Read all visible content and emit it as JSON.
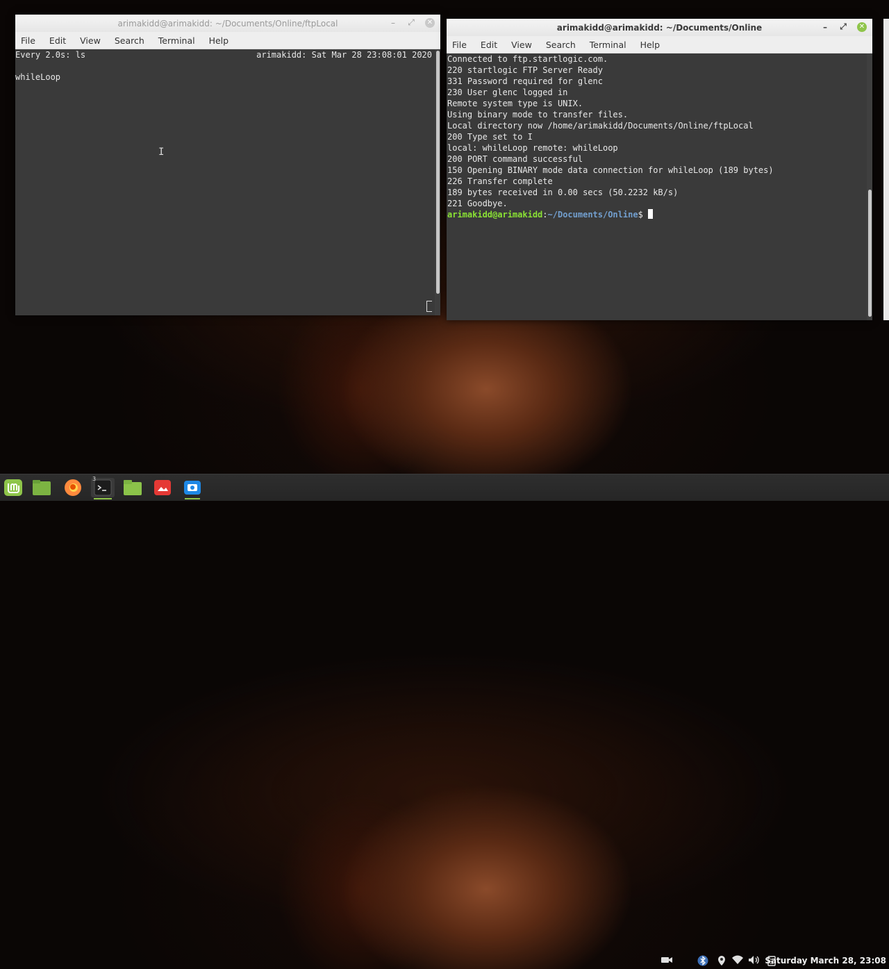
{
  "left_window": {
    "title": "arimakidd@arimakidd: ~/Documents/Online/ftpLocal",
    "menu": [
      "File",
      "Edit",
      "View",
      "Search",
      "Terminal",
      "Help"
    ],
    "header_left": "Every 2.0s: ls",
    "header_right": "arimakidd: Sat Mar 28 23:08:01 2020",
    "listing": [
      "whileLoop"
    ]
  },
  "right_window": {
    "title": "arimakidd@arimakidd: ~/Documents/Online",
    "menu": [
      "File",
      "Edit",
      "View",
      "Search",
      "Terminal",
      "Help"
    ],
    "lines": [
      "Connected to ftp.startlogic.com.",
      "220 startlogic FTP Server Ready",
      "331 Password required for glenc",
      "230 User glenc logged in",
      "Remote system type is UNIX.",
      "Using binary mode to transfer files.",
      "Local directory now /home/arimakidd/Documents/Online/ftpLocal",
      "200 Type set to I",
      "local: whileLoop remote: whileLoop",
      "200 PORT command successful",
      "150 Opening BINARY mode data connection for whileLoop (189 bytes)",
      "226 Transfer complete",
      "189 bytes received in 0.00 secs (50.2232 kB/s)",
      "221 Goodbye."
    ],
    "prompt_user": "arimakidd@arimakidd",
    "prompt_sep": ":",
    "prompt_path": "~/Documents/Online",
    "prompt_symbol": "$ "
  },
  "taskbar": {
    "apps": [
      {
        "icon": "mint-menu-icon",
        "color": "#8fc54a"
      },
      {
        "icon": "files-icon",
        "color": "#7cb342"
      },
      {
        "icon": "firefox-icon",
        "color": "#ff8a3d"
      },
      {
        "icon": "terminal-icon",
        "color": "#222222",
        "badge": "3"
      },
      {
        "icon": "folder-icon",
        "color": "#8bc34a"
      },
      {
        "icon": "screenshot-app-icon",
        "color": "#e53935"
      },
      {
        "icon": "camera-app-icon",
        "color": "#1e88e5"
      }
    ],
    "tray": [
      "video-camera-icon",
      "bluetooth-icon",
      "location-icon",
      "wifi-icon",
      "volume-icon",
      "clipboard-icon"
    ],
    "clock": "Saturday March 28, 23:08"
  }
}
